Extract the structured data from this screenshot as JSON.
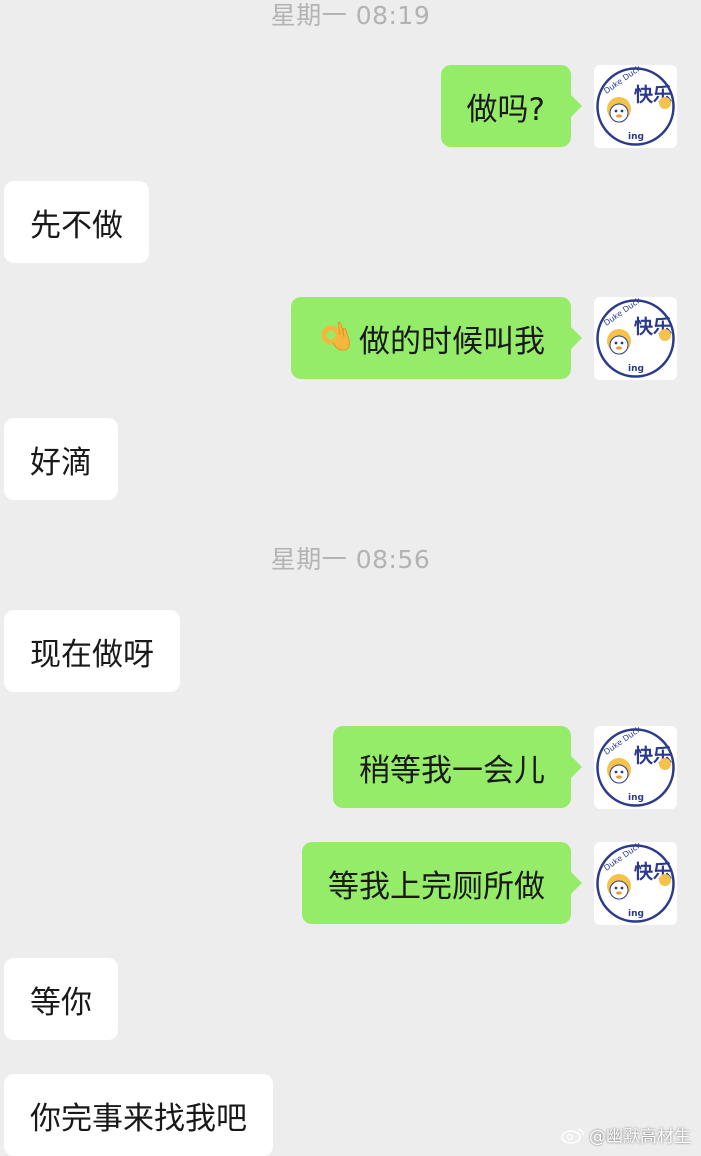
{
  "timestamps": [
    "星期一 08:19",
    "星期一 08:56"
  ],
  "messages": [
    {
      "side": "right",
      "text": "做吗?"
    },
    {
      "side": "left",
      "text": "先不做"
    },
    {
      "side": "right",
      "text": "做的时候叫我",
      "emoji": "ok-hand-icon"
    },
    {
      "side": "left",
      "text": "好滴"
    },
    {
      "side": "left",
      "text": "现在做呀"
    },
    {
      "side": "right",
      "text": "稍等我一会儿"
    },
    {
      "side": "right",
      "text": "等我上完厕所做"
    },
    {
      "side": "left",
      "text": "等你"
    },
    {
      "side": "left",
      "text": "你完事来找我吧"
    }
  ],
  "avatar": {
    "brand": "Duke Duck",
    "label": "快乐",
    "suffix": "ing"
  },
  "watermark": "@幽默高材生",
  "colors": {
    "background": "#ededed",
    "self_bubble": "#95ec69",
    "other_bubble": "#ffffff",
    "timestamp": "#b3b3b3",
    "avatar_text": "#2b3a8c"
  }
}
